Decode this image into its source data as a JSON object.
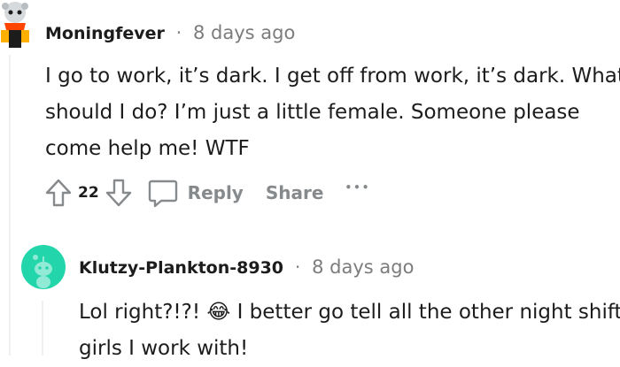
{
  "comment1": {
    "author": "Moningfever",
    "separator": "·",
    "time": "8 days ago",
    "lines": [
      "I go to work, it’s dark. I get off from work, it’s dark. What",
      "should I do? I’m just a little female. Someone please",
      "come help me! WTF"
    ],
    "votes": "22",
    "reply_label": "Reply",
    "share_label": "Share",
    "more_label": "•••"
  },
  "comment2": {
    "author": "Klutzy-Plankton-8930",
    "separator": "·",
    "time": "8 days ago",
    "line1_before": "Lol right?!?! ",
    "emoji": "😂",
    "line1_after": " I better go tell all the other night shift",
    "line2": "girls I work with!"
  },
  "colors": {
    "avatar2_bg": "#23d5ab",
    "avatar1_scarf": "#ff4500",
    "meta_gray": "#7c7c7c",
    "action_gray": "#878a8c",
    "thread_line": "#edeff1"
  }
}
